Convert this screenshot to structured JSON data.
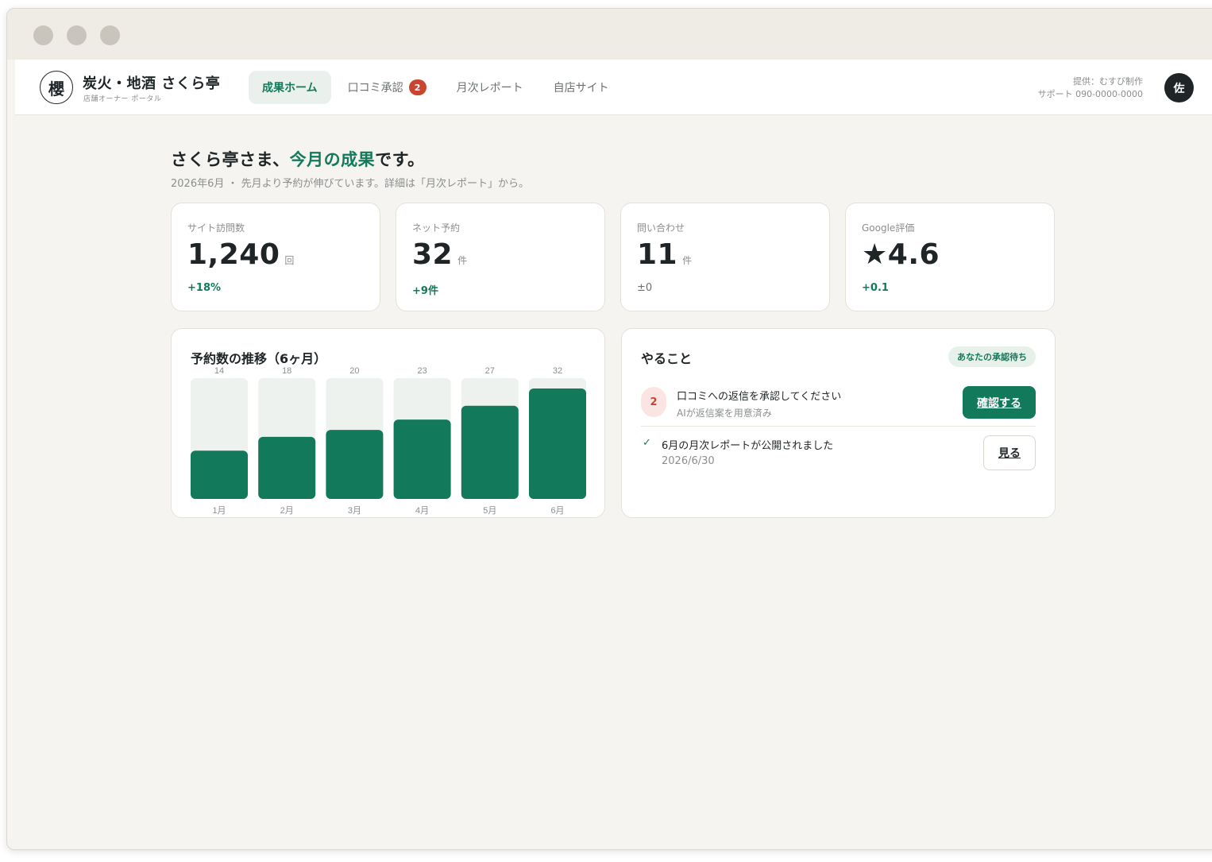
{
  "header": {
    "logo_char": "櫻",
    "brand_name": "炭火・地酒 さくら亭",
    "brand_sub": "店舗オーナー ポータル",
    "nav": [
      {
        "label": "成果ホーム"
      },
      {
        "label": "口コミ承認",
        "badge": "2"
      },
      {
        "label": "月次レポート"
      },
      {
        "label": "自店サイト"
      }
    ],
    "provider": "提供：むすび制作",
    "support": "サポート 090-0000-0000",
    "avatar": "佐"
  },
  "hero": {
    "title_pre": "さくら亭さま、",
    "title_accent": "今月の成果",
    "title_post": "です。",
    "subtitle": "2026年6月 ・ 先月より予約が伸びています。詳細は「月次レポート」から。"
  },
  "kpis": [
    {
      "label": "サイト訪問数",
      "value": "1,240",
      "unit": "回",
      "delta": "+18%"
    },
    {
      "label": "ネット予約",
      "value": "32",
      "unit": "件",
      "delta": "+9件"
    },
    {
      "label": "問い合わせ",
      "value": "11",
      "unit": "件",
      "delta": "±0"
    },
    {
      "label": "Google評価",
      "value": "★4.6",
      "unit": "",
      "delta": "+0.1"
    }
  ],
  "chart_data": {
    "type": "bar",
    "title": "予約数の推移（6ヶ月）",
    "categories": [
      "1月",
      "2月",
      "3月",
      "4月",
      "5月",
      "6月"
    ],
    "values": [
      14,
      18,
      20,
      23,
      27,
      32
    ],
    "ylim": [
      0,
      35
    ]
  },
  "todo": {
    "title": "やること",
    "pill": "あなたの承認待ち",
    "items": [
      {
        "num": "2",
        "main": "口コミへの返信を承認してください",
        "sub": "AIが返信案を用意済み",
        "button": "確認する"
      },
      {
        "check": "✓",
        "main": "6月の月次レポートが公開されました",
        "sub": "2026/6/30",
        "button": "見る"
      }
    ]
  },
  "colors": {
    "accent": "#13795b",
    "bar_track": "#edf2ef",
    "badge": "#c9452f",
    "background": "#f5f4f0"
  }
}
